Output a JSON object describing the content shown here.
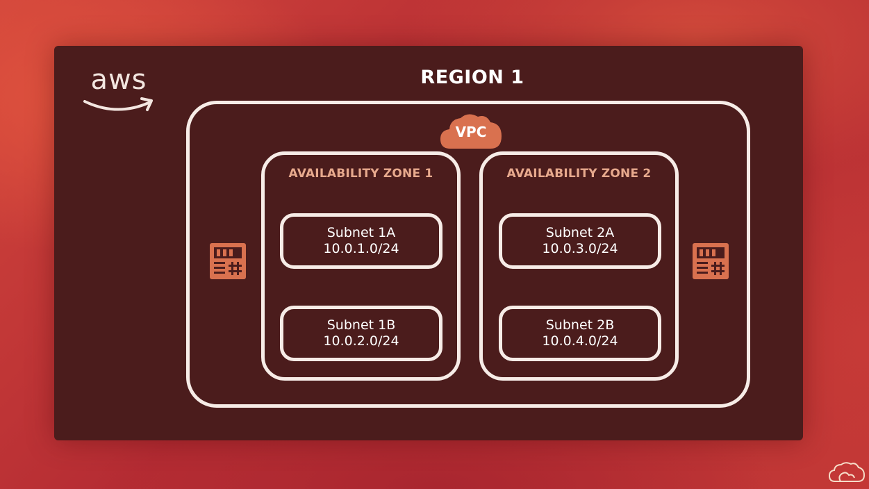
{
  "logo": {
    "text": "aws"
  },
  "region": {
    "title": "REGION 1"
  },
  "vpc": {
    "label": "VPC"
  },
  "zones": [
    {
      "title": "AVAILABILITY ZONE 1",
      "subnets": [
        {
          "name": "Subnet 1A",
          "cidr": "10.0.1.0/24"
        },
        {
          "name": "Subnet 1B",
          "cidr": "10.0.2.0/24"
        }
      ]
    },
    {
      "title": "AVAILABILITY ZONE 2",
      "subnets": [
        {
          "name": "Subnet 2A",
          "cidr": "10.0.3.0/24"
        },
        {
          "name": "Subnet 2B",
          "cidr": "10.0.4.0/24"
        }
      ]
    }
  ],
  "icons": {
    "router_left": "router-icon",
    "router_right": "router-icon",
    "vpc_cloud": "cloud-icon",
    "corner_brand": "cloud-brand-icon"
  },
  "colors": {
    "panel": "#4b1c1c",
    "outline": "#f7ece7",
    "zone_title": "#e7a98d",
    "accent": "#d9714f"
  }
}
